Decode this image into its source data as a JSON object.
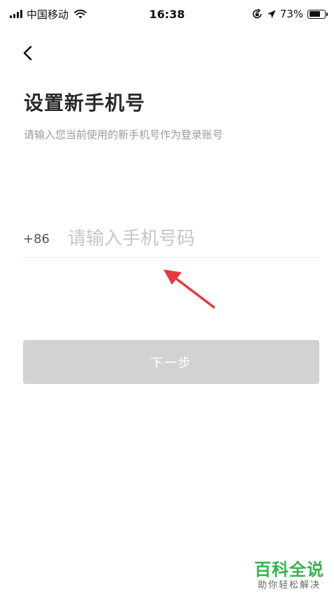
{
  "status_bar": {
    "carrier": "中国移动",
    "time": "16:38",
    "battery_percent": "73%",
    "battery_level": 0.73,
    "icons": [
      "signal-icon",
      "wifi-icon",
      "orientation-lock-icon",
      "location-icon",
      "battery-icon"
    ]
  },
  "nav": {
    "back_icon": "chevron-left-icon"
  },
  "header": {
    "title": "设置新手机号",
    "subtitle": "请输入您当前使用的新手机号作为登录账号"
  },
  "phone_field": {
    "country_code": "+86",
    "value": "",
    "placeholder": "请输入手机号码"
  },
  "next_button": {
    "label": "下一步",
    "enabled": false
  },
  "annotation": {
    "icon": "red-arrow-icon",
    "color": "#e8383d"
  },
  "watermark": {
    "title": "百科全说",
    "subtitle": "助你轻松解决",
    "color": "#36b34a"
  }
}
